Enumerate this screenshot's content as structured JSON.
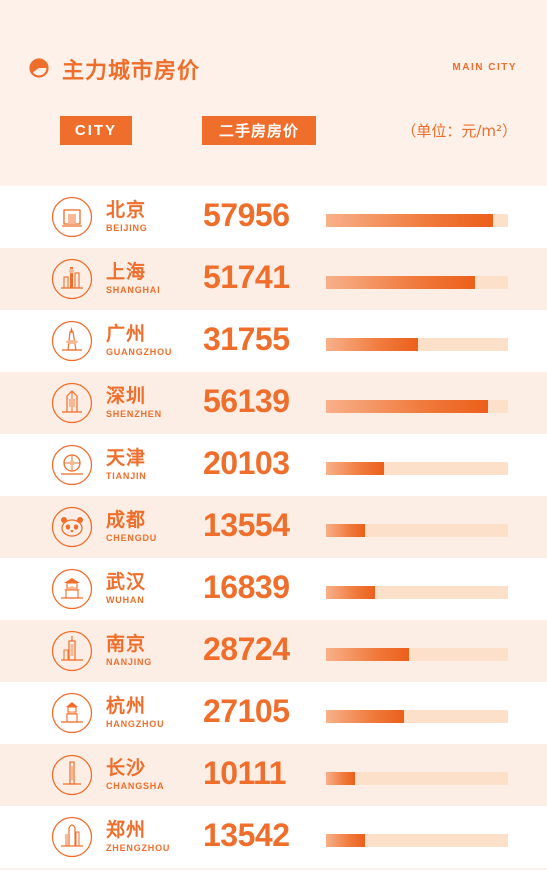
{
  "header": {
    "title": "主力城市房价",
    "subtitle": "MAIN CITY",
    "city_label": "CITY",
    "price_label": "二手房房价",
    "unit": "（单位：元/m²）"
  },
  "colors": {
    "accent": "#ef6e2b",
    "track": "#fde0c9",
    "bg": "#fdf1ea"
  },
  "chart_data": {
    "type": "bar",
    "title": "主力城市房价",
    "unit": "元/m²",
    "categories": [
      "北京",
      "上海",
      "广州",
      "深圳",
      "天津",
      "成都",
      "武汉",
      "南京",
      "杭州",
      "长沙",
      "郑州"
    ],
    "categories_en": [
      "BEIJING",
      "SHANGHAI",
      "GUANGZHOU",
      "SHENZHEN",
      "TIANJIN",
      "CHENGDU",
      "WUHAN",
      "NANJING",
      "HANGZHOU",
      "CHANGSHA",
      "ZHENGZHOU"
    ],
    "values": [
      57956,
      51741,
      31755,
      56139,
      20103,
      13554,
      16839,
      28724,
      27105,
      10111,
      13542
    ],
    "value_labels": [
      "57956",
      "51741",
      "31755",
      "56139",
      "20103",
      "13554",
      "16839",
      "28724",
      "27105",
      "10111",
      "13542"
    ],
    "xlim": [
      0,
      63000
    ]
  },
  "rows": [
    {
      "icon": "beijing-landmark-icon",
      "name_cn": "北京",
      "name_en": "BEIJING",
      "price": "57956"
    },
    {
      "icon": "shanghai-tower-icon",
      "name_cn": "上海",
      "name_en": "SHANGHAI",
      "price": "51741"
    },
    {
      "icon": "guangzhou-landmark-icon",
      "name_cn": "广州",
      "name_en": "GUANGZHOU",
      "price": "31755"
    },
    {
      "icon": "shenzhen-tower-icon",
      "name_cn": "深圳",
      "name_en": "SHENZHEN",
      "price": "56139"
    },
    {
      "icon": "tianjin-ferris-wheel-icon",
      "name_cn": "天津",
      "name_en": "TIANJIN",
      "price": "20103"
    },
    {
      "icon": "panda-icon",
      "name_cn": "成都",
      "name_en": "CHENGDU",
      "price": "13554"
    },
    {
      "icon": "yellow-crane-tower-icon",
      "name_cn": "武汉",
      "name_en": "WUHAN",
      "price": "16839"
    },
    {
      "icon": "nanjing-tower-icon",
      "name_cn": "南京",
      "name_en": "NANJING",
      "price": "28724"
    },
    {
      "icon": "leifeng-pagoda-icon",
      "name_cn": "杭州",
      "name_en": "HANGZHOU",
      "price": "27105"
    },
    {
      "icon": "changsha-tower-icon",
      "name_cn": "长沙",
      "name_en": "CHANGSHA",
      "price": "10111"
    },
    {
      "icon": "zhengzhou-tower-icon",
      "name_cn": "郑州",
      "name_en": "ZHENGZHOU",
      "price": "13542"
    }
  ]
}
